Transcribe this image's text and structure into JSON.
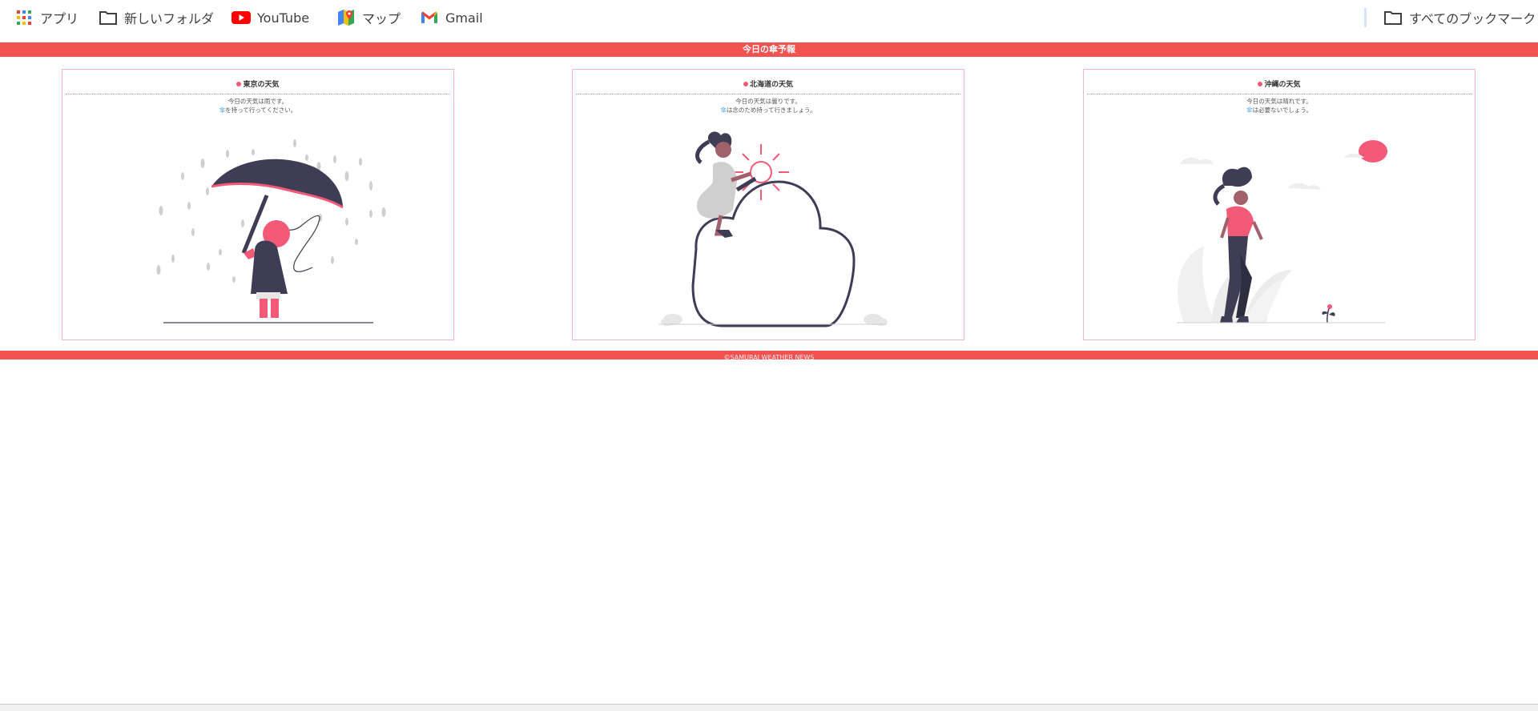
{
  "bookmarks": {
    "apps": "アプリ",
    "new_folder": "新しいフォルダ",
    "youtube": "YouTube",
    "maps": "マップ",
    "gmail": "Gmail",
    "all_bookmarks": "すべてのブックマーク"
  },
  "header": {
    "title": "今日の傘予報"
  },
  "cards": [
    {
      "title": "東京の天気",
      "line1": "今日の天気は雨です。",
      "umbrella": "傘",
      "line2_rest": "を持って行ってください。",
      "weather": "rain"
    },
    {
      "title": "北海道の天気",
      "line1": "今日の天気は曇りです。",
      "umbrella": "傘",
      "line2_rest": "は念のため持って行きましょう。",
      "weather": "cloudy"
    },
    {
      "title": "沖縄の天気",
      "line1": "今日の天気は晴れです。",
      "umbrella": "傘",
      "line2_rest": "は必要ないでしょう。",
      "weather": "sunny"
    }
  ],
  "footer": {
    "text": "©SAMURAI WEATHER NEWS"
  },
  "colors": {
    "accent": "#f25250",
    "pink": "#f25a78",
    "dark": "#3f3d56"
  }
}
